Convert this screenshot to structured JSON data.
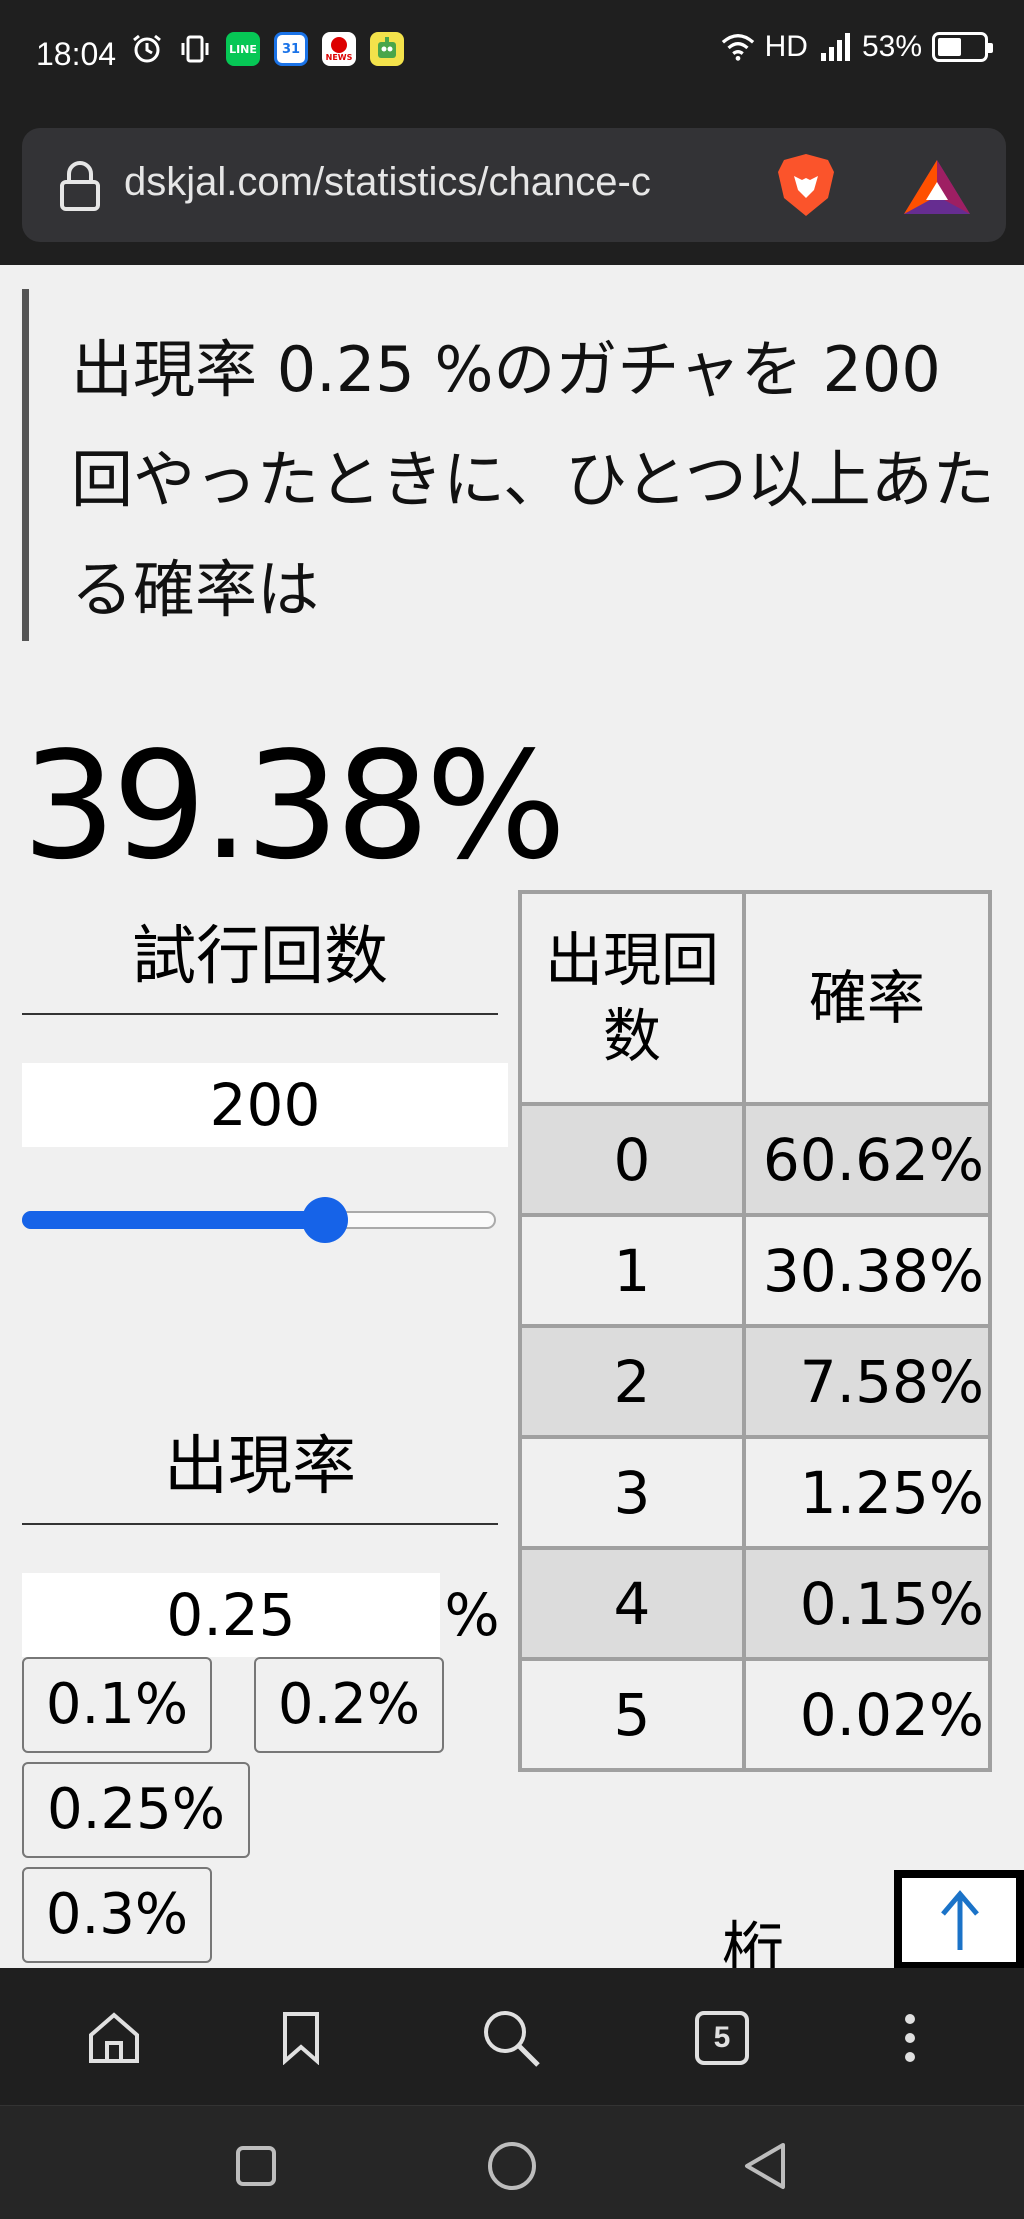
{
  "status_bar": {
    "time": "18:04",
    "network": "HD",
    "battery_percent": "53%",
    "battery_level": 0.53,
    "notification_icons": [
      "alarm-icon",
      "vibrate-icon",
      "line-app-icon",
      "calendar-icon",
      "news-app-icon",
      "robot-app-icon"
    ]
  },
  "browser": {
    "url": "dskjal.com/statistics/chance-c",
    "calendar_day": "31",
    "news_label": "NEWS",
    "line_label": "LINE"
  },
  "page": {
    "quote": "出現率 0.25 %のガチャを 200 回やったときに、ひとつ以上あたる確率は",
    "result": "39.38%",
    "trials": {
      "title": "試行回数",
      "value": "200",
      "slider_fraction": 0.64
    },
    "rate": {
      "title": "出現率",
      "value": "0.25",
      "unit": "%",
      "presets": [
        "0.1%",
        "0.2%",
        "0.25%",
        "0.3%"
      ]
    },
    "table": {
      "headers": [
        "出現回数",
        "確率"
      ],
      "rows": [
        {
          "count": "0",
          "prob": "60.62%"
        },
        {
          "count": "1",
          "prob": "30.38%"
        },
        {
          "count": "2",
          "prob": "7.58%"
        },
        {
          "count": "3",
          "prob": "1.25%"
        },
        {
          "count": "4",
          "prob": "0.15%"
        },
        {
          "count": "5",
          "prob": "0.02%"
        }
      ]
    },
    "digits_label": "桁",
    "back_to_top": "↑"
  },
  "toolbar": {
    "tab_count": "5"
  },
  "colors": {
    "accent": "#1663e8",
    "dark_bar": "#1f1f1f",
    "page_bg": "#f0f0f0",
    "table_border": "#a0a0a0",
    "row_shaded": "#dcdcdc"
  }
}
